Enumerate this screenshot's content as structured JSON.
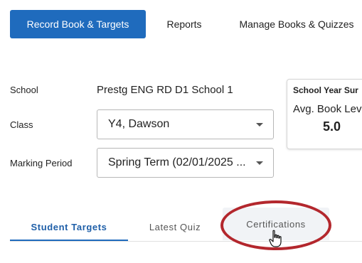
{
  "nav": {
    "tabs": [
      {
        "label": "Record Book & Targets",
        "active": true
      },
      {
        "label": "Reports",
        "active": false
      },
      {
        "label": "Manage Books & Quizzes",
        "active": false
      }
    ]
  },
  "form": {
    "school_label": "School",
    "school_value": "Prestg ENG RD D1 School 1",
    "class_label": "Class",
    "class_value": "Y4, Dawson",
    "marking_period_label": "Marking Period",
    "marking_period_value": "Spring Term (02/01/2025 ..."
  },
  "summary": {
    "title": "School Year Sur",
    "metric_label": "Avg. Book Lev",
    "metric_value": "5.0"
  },
  "subtabs": [
    {
      "label": "Student Targets",
      "active": true
    },
    {
      "label": "Latest Quiz",
      "active": false
    },
    {
      "label": "Certifications",
      "active": false,
      "highlighted": true
    }
  ],
  "colors": {
    "primary": "#1f6bbd",
    "highlight_ring": "#b3272d"
  }
}
